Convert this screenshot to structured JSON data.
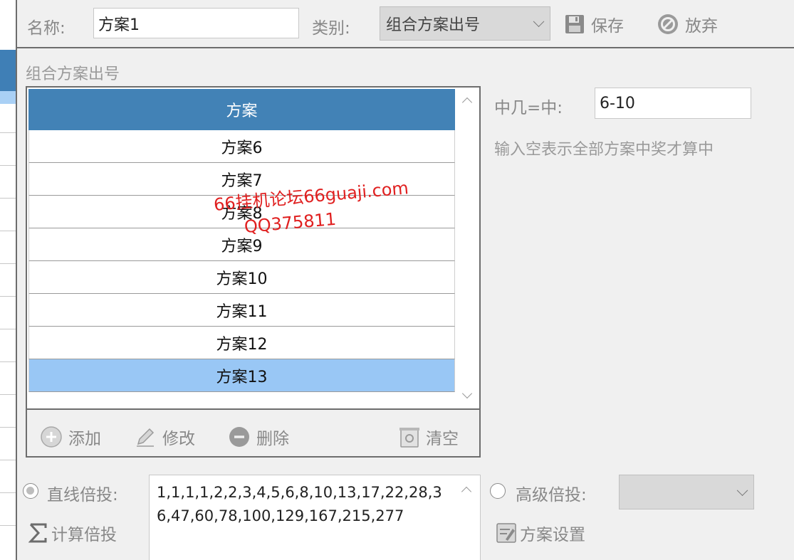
{
  "header": {
    "name_label": "名称:",
    "name_value": "方案1",
    "category_label": "类别:",
    "category_value": "组合方案出号",
    "save_label": "保存",
    "discard_label": "放弃"
  },
  "section": {
    "title": "组合方案出号"
  },
  "plan_list": {
    "column_header": "方案",
    "rows": [
      "方案6",
      "方案7",
      "方案8",
      "方案9",
      "方案10",
      "方案11",
      "方案12",
      "方案13"
    ],
    "selected_index": 7
  },
  "list_actions": {
    "add_label": "添加",
    "edit_label": "修改",
    "delete_label": "删除",
    "clear_label": "清空"
  },
  "hit_setting": {
    "label": "中几=中:",
    "value": "6-10",
    "hint": "输入空表示全部方案中奖才算中"
  },
  "watermark": {
    "line1": "66挂机论坛66guaji.com",
    "line2": "QQ375811"
  },
  "multiplier": {
    "linear_label": "直线倍投:",
    "calc_label": "计算倍投",
    "sequence": "1,1,1,1,2,2,3,4,5,6,8,10,13,17,22,28,36,47,60,78,100,129,167,215,277",
    "advanced_label": "高级倍投:",
    "advanced_value": "",
    "plan_settings_label": "方案设置"
  },
  "colors": {
    "header_blue": "#4282b6",
    "selected_row": "#99c7f5",
    "watermark": "#e02020"
  }
}
